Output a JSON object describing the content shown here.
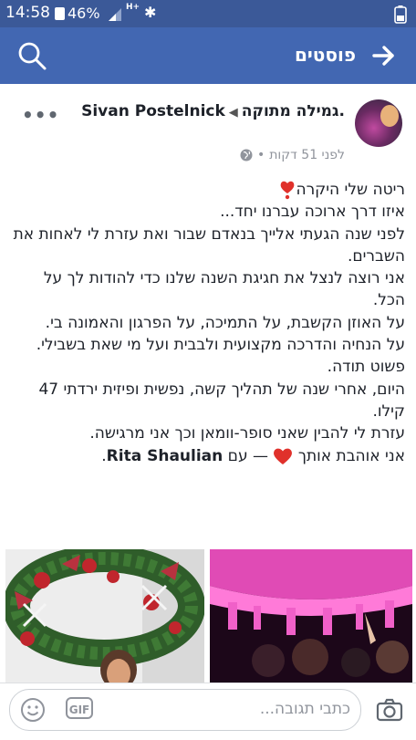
{
  "status_bar": {
    "time": "14:58",
    "battery_percent": "46%",
    "network": "H+"
  },
  "app_bar": {
    "title": "פוסטים"
  },
  "post": {
    "author_prefix": "Sivan Postelnick",
    "recipient": ".גמילה מתוקה",
    "timestamp": "לפני 51 דקות",
    "separator": "•",
    "lines": [
      "ריטה שלי היקרה",
      "איזו דרך ארוכה עברנו יחד...",
      "לפני שנה הגעתי אלייך בנאדם שבור ואת עזרת לי לאחות את השברים.",
      "אני רוצה לנצל את חגיגת השנה שלנו כדי להודות לך על הכל.",
      "על האוזן הקשבת, על התמיכה, על הפרגון והאמונה בי.",
      "על הנחיה והדרכה מקצועית ולבבית ועל מי שאת בשבילי.",
      "פשוט תודה.",
      "היום, אחרי שנה של תהליך קשה, נפשית ופיזית ירדתי 47 קילו.",
      "עזרת לי להבין שאני סופר-וומאן וכך אני מרגישה."
    ],
    "closing_text": "אני אוהבת אותך",
    "with_text": "— עם",
    "tagged_person": "Rita Shaulian",
    "tagged_suffix": "."
  },
  "comment_bar": {
    "placeholder": "כתבי תגובה...",
    "gif_label": "GIF"
  },
  "colors": {
    "header": "#4267b2",
    "status": "#3b5998",
    "heart": "#e0312b"
  },
  "icons": [
    "search-icon",
    "back-arrow-icon",
    "more-icon",
    "globe-icon",
    "heart-icon",
    "smile-icon",
    "gif-icon",
    "camera-icon"
  ]
}
